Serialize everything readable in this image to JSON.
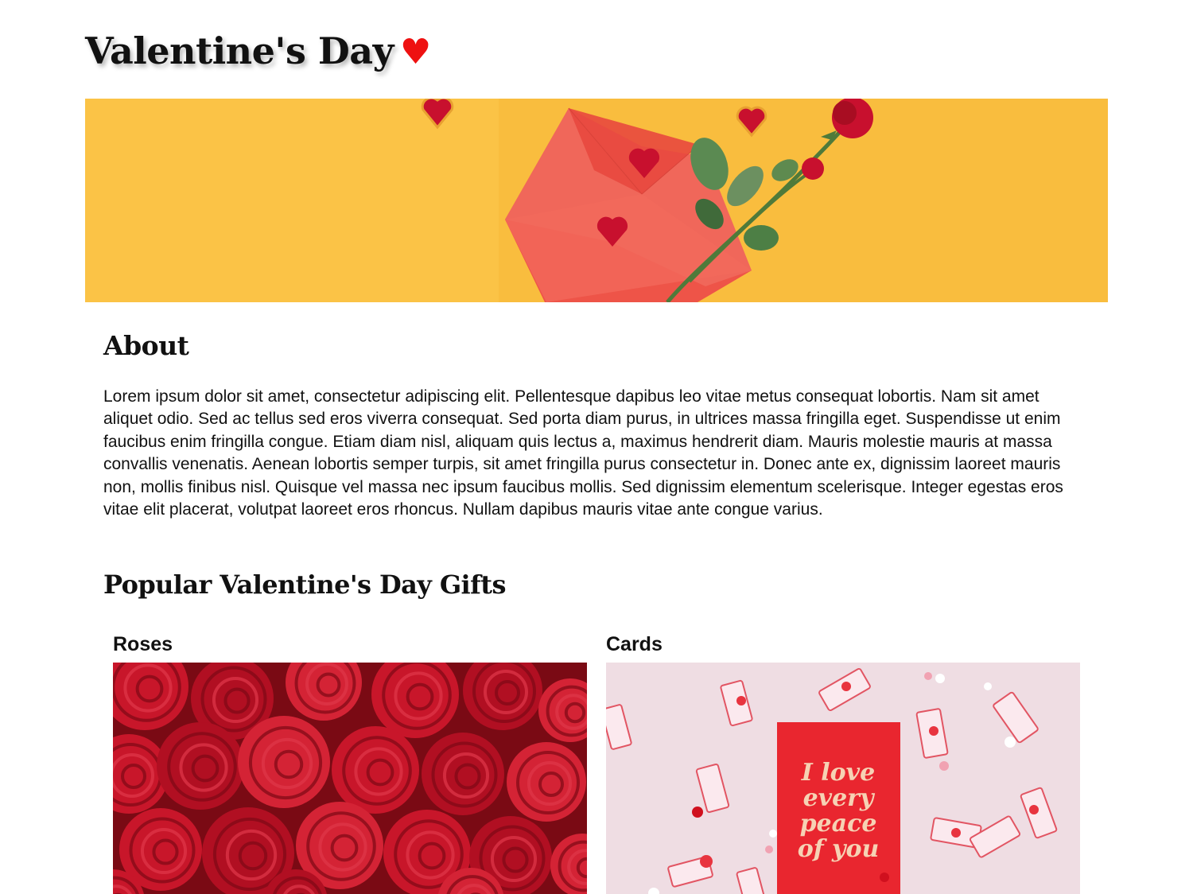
{
  "header": {
    "title": "Valentine's Day",
    "heart": "♥"
  },
  "hero": {
    "image_label": "envelope-roses-hearts-banner",
    "background_color": "#f9bd3e"
  },
  "about": {
    "heading": "About",
    "body": "Lorem ipsum dolor sit amet, consectetur adipiscing elit. Pellentesque dapibus leo vitae metus consequat lobortis. Nam sit amet aliquet odio. Sed ac tellus sed eros viverra consequat. Sed porta diam purus, in ultrices massa fringilla eget. Suspendisse ut enim faucibus enim fringilla congue. Etiam diam nisl, aliquam quis lectus a, maximus hendrerit diam. Mauris molestie mauris at massa convallis venenatis. Aenean lobortis semper turpis, sit amet fringilla purus consectetur in. Donec ante ex, dignissim laoreet mauris non, mollis finibus nisl. Quisque vel massa nec ipsum faucibus mollis. Sed dignissim elementum scelerisque. Integer egestas eros vitae elit placerat, volutpat laoreet eros rhoncus. Nullam dapibus mauris vitae ante congue varius."
  },
  "gifts": {
    "heading": "Popular Valentine's Day Gifts",
    "items": [
      {
        "label": "Roses",
        "image_label": "red-roses-photo"
      },
      {
        "label": "Cards",
        "image_label": "love-card-photo",
        "card_text": "I love every peace of you"
      }
    ]
  },
  "colors": {
    "heart_red": "#ee1111",
    "hero_yellow": "#f9bd3e",
    "rose_red": "#c01020",
    "card_bg": "#efdde3"
  }
}
